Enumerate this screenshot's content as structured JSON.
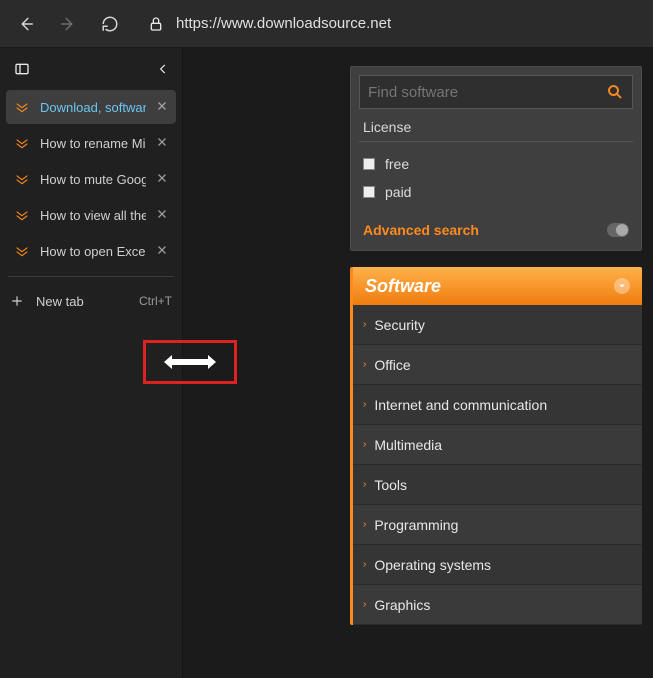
{
  "toolbar": {
    "url": "https://www.downloadsource.net"
  },
  "sidebar": {
    "tabs": [
      {
        "title": "Download, software",
        "active": true
      },
      {
        "title": "How to rename Mic",
        "active": false
      },
      {
        "title": "How to mute Googl",
        "active": false
      },
      {
        "title": "How to view all the",
        "active": false
      },
      {
        "title": "How to open Excel,",
        "active": false
      }
    ],
    "newtab_label": "New tab",
    "newtab_shortcut": "Ctrl+T"
  },
  "search": {
    "placeholder": "Find software",
    "license_heading": "License",
    "free_label": "free",
    "paid_label": "paid",
    "advanced_label": "Advanced search"
  },
  "categories": {
    "heading": "Software",
    "items": [
      "Security",
      "Office",
      "Internet and communication",
      "Multimedia",
      "Tools",
      "Programming",
      "Operating systems",
      "Graphics"
    ]
  }
}
